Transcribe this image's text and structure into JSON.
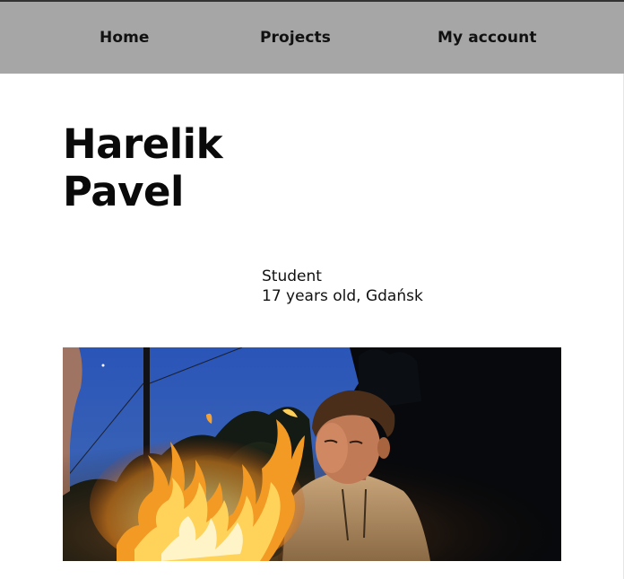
{
  "nav": {
    "items": [
      {
        "label": "Home"
      },
      {
        "label": "Projects"
      },
      {
        "label": "My account"
      }
    ]
  },
  "profile": {
    "surname": "Harelik",
    "first_name": "Pavel",
    "occupation": "Student",
    "age_location": "17 years old, Gdańsk"
  },
  "colors": {
    "nav_bg": "#a6a6a6",
    "page_bg": "#ffffff",
    "text": "#111111"
  }
}
